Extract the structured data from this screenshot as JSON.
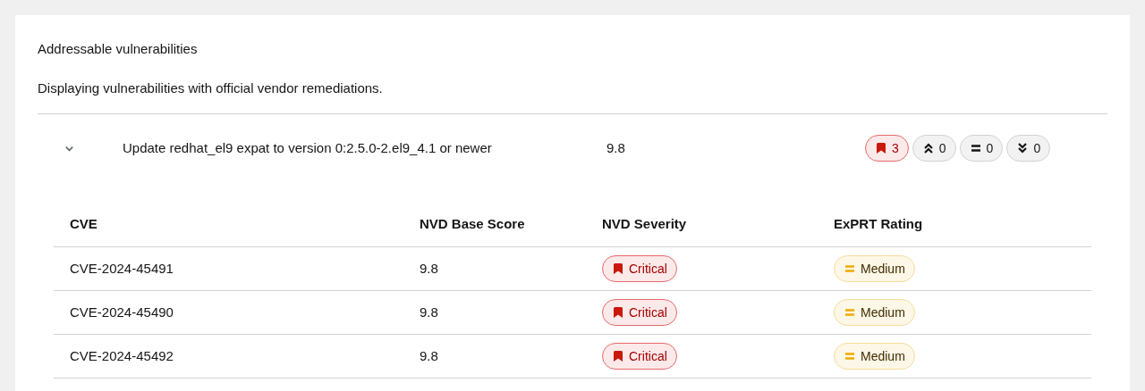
{
  "title": "Addressable vulnerabilities",
  "description": "Displaying vulnerabilities with official vendor remediations.",
  "remediations": [
    {
      "expanded": true,
      "label": "Update redhat_el9 expat to version 0:2.5.0-2.el9_4.1 or newer",
      "score": "9.8",
      "counts": [
        {
          "kind": "critical",
          "count": "3"
        },
        {
          "kind": "important",
          "count": "0"
        },
        {
          "kind": "moderate",
          "count": "0"
        },
        {
          "kind": "low",
          "count": "0"
        }
      ],
      "table": {
        "columns": [
          "CVE",
          "NVD Base Score",
          "NVD Severity",
          "ExPRT Rating"
        ],
        "rows": [
          {
            "cve": "CVE-2024-45491",
            "score": "9.8",
            "severity": {
              "kind": "critical",
              "label": "Critical"
            },
            "rating": {
              "kind": "moderate",
              "label": "Medium"
            }
          },
          {
            "cve": "CVE-2024-45490",
            "score": "9.8",
            "severity": {
              "kind": "critical",
              "label": "Critical"
            },
            "rating": {
              "kind": "moderate",
              "label": "Medium"
            }
          },
          {
            "cve": "CVE-2024-45492",
            "score": "9.8",
            "severity": {
              "kind": "critical",
              "label": "Critical"
            },
            "rating": {
              "kind": "moderate",
              "label": "Medium"
            }
          }
        ]
      }
    }
  ]
}
